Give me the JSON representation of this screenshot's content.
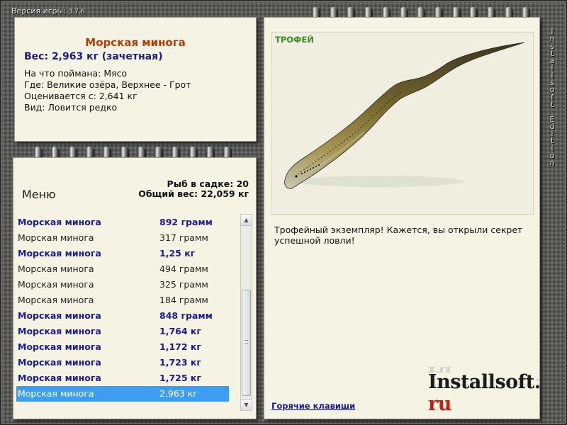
{
  "window": {
    "version_label": "Версия игры:",
    "version_number": "3.7.6"
  },
  "fish_info": {
    "title": "Морская минога",
    "weight": "Вес: 2,963 кг (зачетная)",
    "bait": "На что поймана: Мясо",
    "location": "Где: Великие озёра, Верхнее - Грот",
    "threshold": "Оценивается с: 2,641 кг",
    "rarity": "Вид: Ловится редко"
  },
  "menu": {
    "title": "Меню",
    "fish_count": "Рыб в садке: 20",
    "total_weight": "Общий вес: 22,059 кг"
  },
  "catch_list": [
    {
      "name": "Морская минога",
      "weight": "892 грамм",
      "trophy": true
    },
    {
      "name": "Морская минога",
      "weight": "317 грамм",
      "trophy": false
    },
    {
      "name": "Морская минога",
      "weight": "1,25 кг",
      "trophy": true
    },
    {
      "name": "Морская минога",
      "weight": "494 грамм",
      "trophy": false
    },
    {
      "name": "Морская минога",
      "weight": "325 грамм",
      "trophy": false
    },
    {
      "name": "Морская минога",
      "weight": "184 грамм",
      "trophy": false
    },
    {
      "name": "Морская минога",
      "weight": "848 грамм",
      "trophy": true
    },
    {
      "name": "Морская минога",
      "weight": "1,764 кг",
      "trophy": true
    },
    {
      "name": "Морская минога",
      "weight": "1,172 кг",
      "trophy": true
    },
    {
      "name": "Морская минога",
      "weight": "1,723 кг",
      "trophy": true
    },
    {
      "name": "Морская минога",
      "weight": "1,725 кг",
      "trophy": true
    },
    {
      "name": "Морская минога",
      "weight": "2,963 кг",
      "trophy": true,
      "selected": true
    }
  ],
  "trophy_panel": {
    "badge": "ТРОФЕЙ",
    "description": "Трофейный экземпляр! Кажется, вы открыли секрет успешной ловли!",
    "hotkeys_link": "Горячие клавиши"
  },
  "branding": {
    "logo_main": "Installsoft.",
    "logo_suffix": "ru",
    "side_text": "Installsoft Edition"
  },
  "colors": {
    "title_orange": "#b03c0a",
    "trophy_blue": "#1a1a9c",
    "selected_row": "#3d9df2",
    "trophy_green": "#3c8a1e",
    "logo_red": "#cc1c10"
  }
}
